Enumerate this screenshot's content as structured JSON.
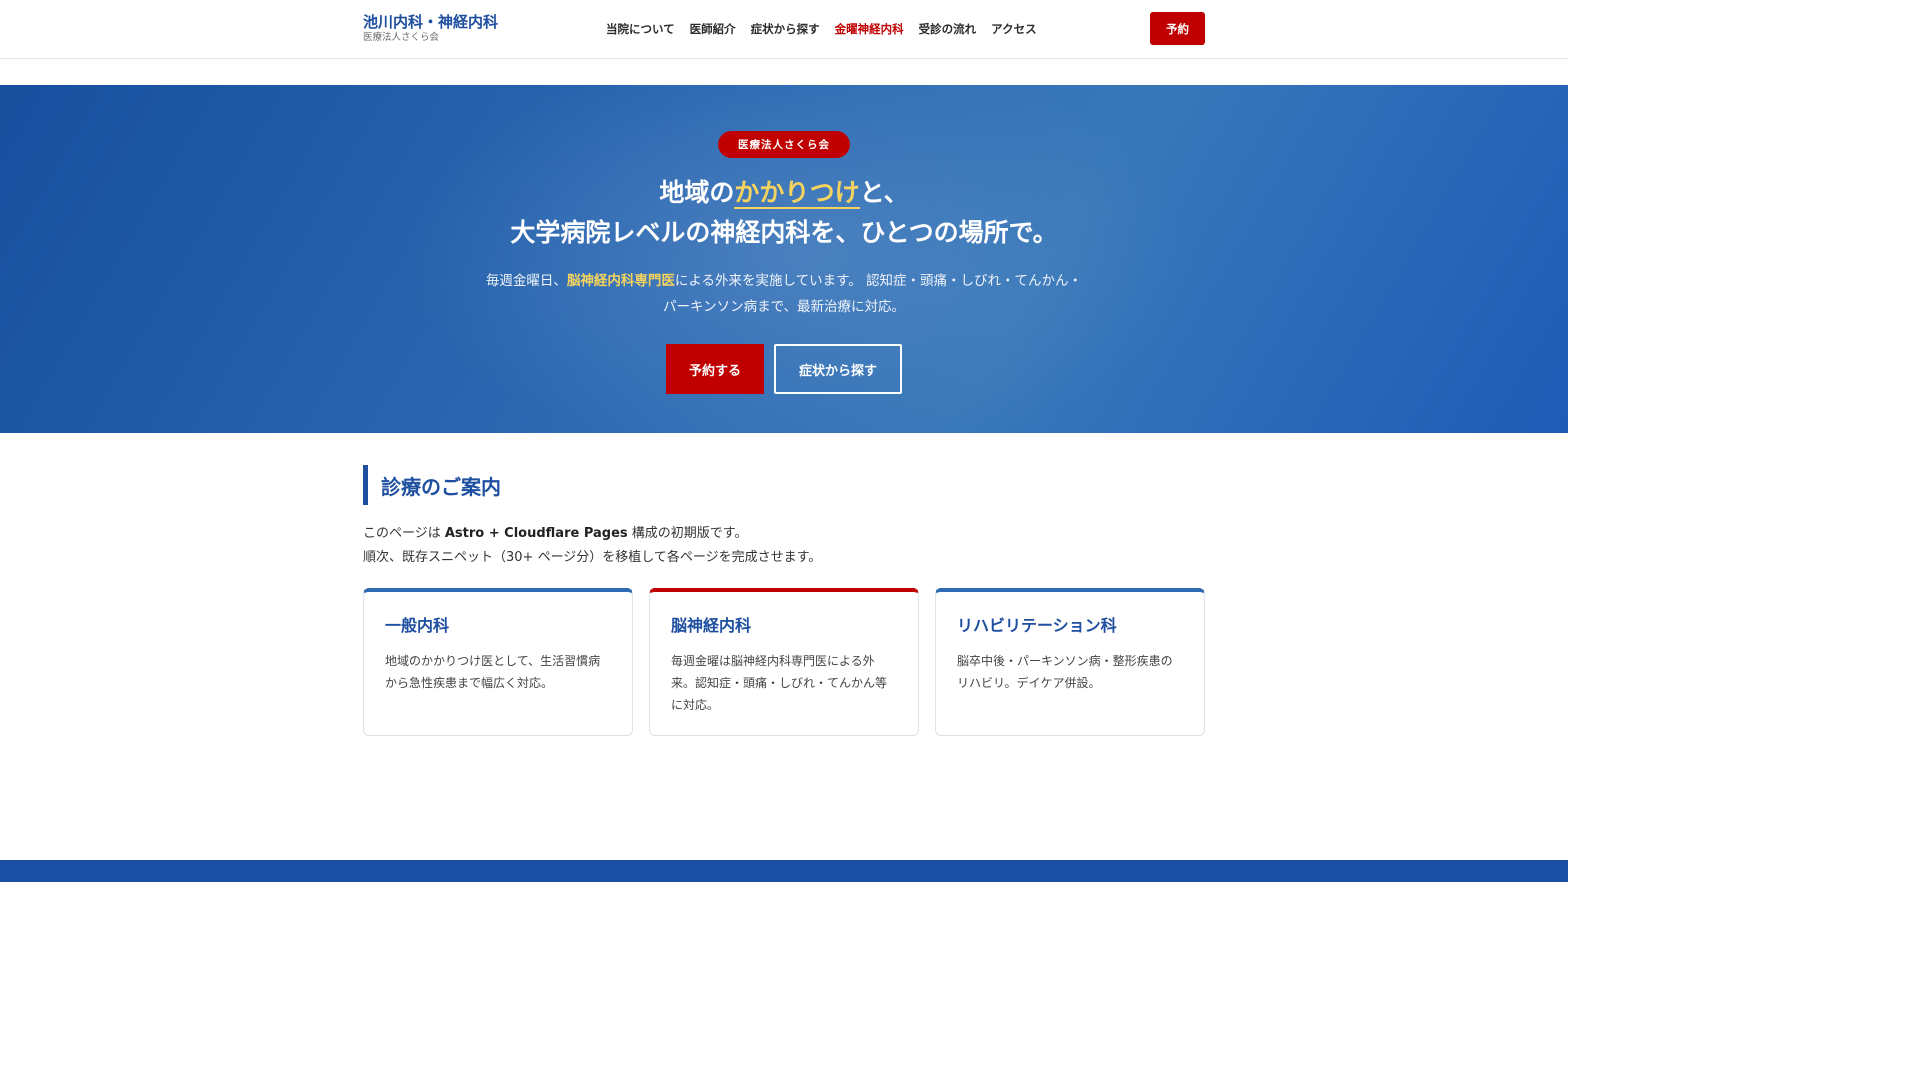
{
  "header": {
    "brand_name": "池川内科・神経内科",
    "brand_sub": "医療法人さくら会",
    "nav": [
      {
        "label": "当院について",
        "active": false
      },
      {
        "label": "医師紹介",
        "active": false
      },
      {
        "label": "症状から探す",
        "active": false
      },
      {
        "label": "金曜神経内科",
        "active": true
      },
      {
        "label": "受診の流れ",
        "active": false
      },
      {
        "label": "アクセス",
        "active": false
      }
    ],
    "reserve_label": "予約"
  },
  "hero": {
    "badge": "医療法人さくら会",
    "title_line1_pre": "地域の",
    "title_line1_hl": "かかりつけ",
    "title_line1_post": "と、",
    "title_line2": "大学病院レベルの神経内科を、ひとつの場所で。",
    "desc_pre": "毎週金曜日、",
    "desc_hl": "脳神経内科専門医",
    "desc_post": "による外来を実施しています。 認知症・頭痛・しびれ・てんかん・",
    "desc_line2": "パーキンソン病まで、最新治療に対応。",
    "primary_button": "予約する",
    "secondary_button": "症状から探す"
  },
  "section": {
    "heading": "診療のご案内",
    "line1_pre": "このページは ",
    "line1_bold": "Astro + Cloudflare Pages",
    "line1_post": " 構成の初期版です。",
    "line2": "順次、既存スニペット（30+ ページ分）を移植して各ページを完成させます。"
  },
  "cards": [
    {
      "title": "一般内科",
      "body": "地域のかかりつけ医として、生活習慣病から急性疾患まで幅広く対応。",
      "accent": "#2e6bb3"
    },
    {
      "title": "脳神経内科",
      "body": "毎週金曜は脳神経内科専門医による外来。認知症・頭痛・しびれ・てんかん等に対応。",
      "accent": "#c00000"
    },
    {
      "title": "リハビリテーション科",
      "body": "脳卒中後・パーキンソン病・整形疾患のリハビリ。デイケア併設。",
      "accent": "#2e6bb3"
    }
  ],
  "colors": {
    "brand_blue": "#1f4fa0",
    "accent_red": "#c00000",
    "highlight_yellow": "#f4d35e"
  }
}
